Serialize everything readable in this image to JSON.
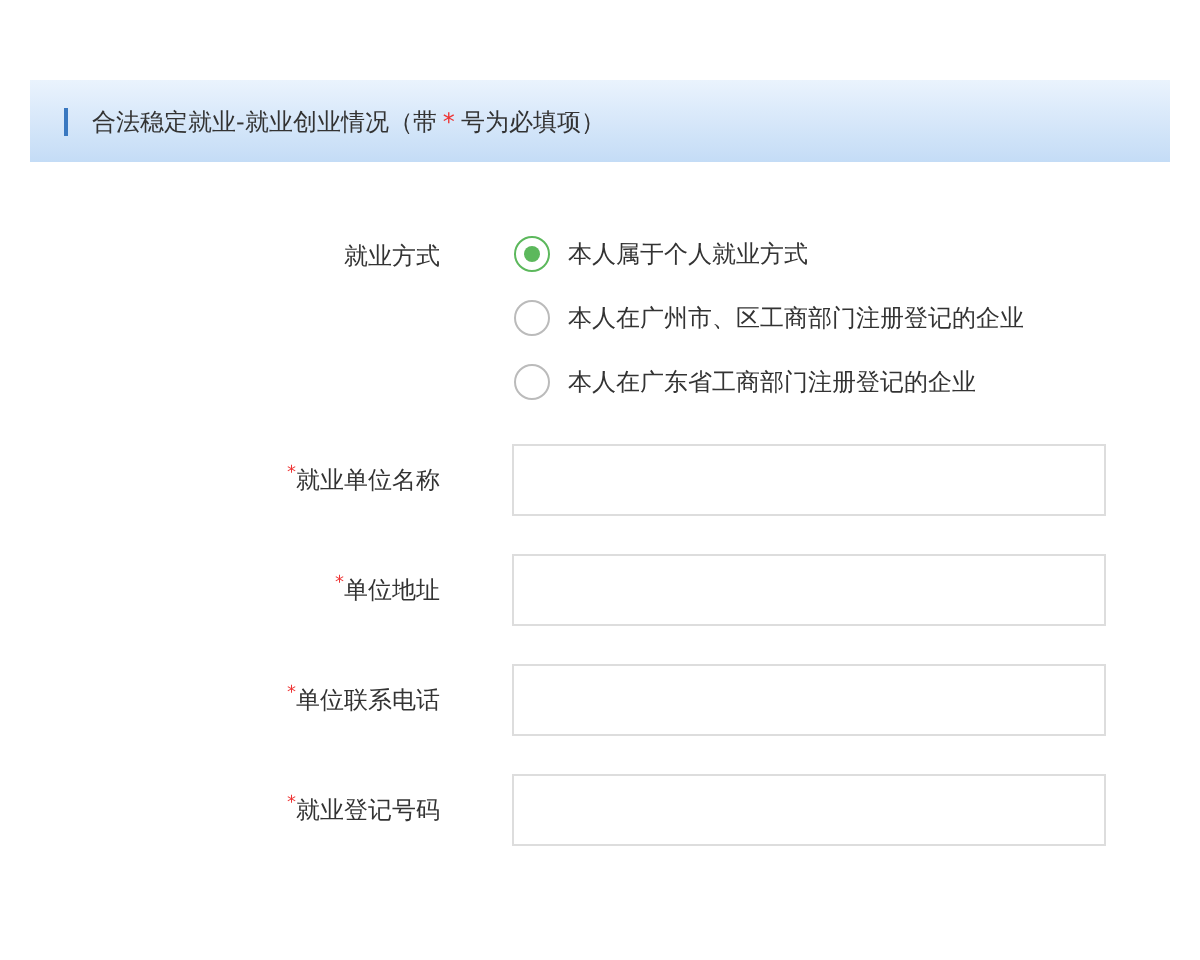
{
  "section_header": {
    "title": "合法稳定就业-就业创业情况（带",
    "required_mark": "*",
    "title_end": "号为必填项）"
  },
  "employment_type": {
    "label": "就业方式",
    "options": [
      {
        "label": "本人属于个人就业方式",
        "selected": true
      },
      {
        "label": "本人在广州市、区工商部门注册登记的企业",
        "selected": false
      },
      {
        "label": "本人在广东省工商部门注册登记的企业",
        "selected": false
      }
    ]
  },
  "fields": [
    {
      "required_mark": "*",
      "label": "就业单位名称"
    },
    {
      "required_mark": "*",
      "label": "单位地址"
    },
    {
      "required_mark": "*",
      "label": "单位联系电话"
    },
    {
      "required_mark": "*",
      "label": "就业登记号码"
    }
  ]
}
